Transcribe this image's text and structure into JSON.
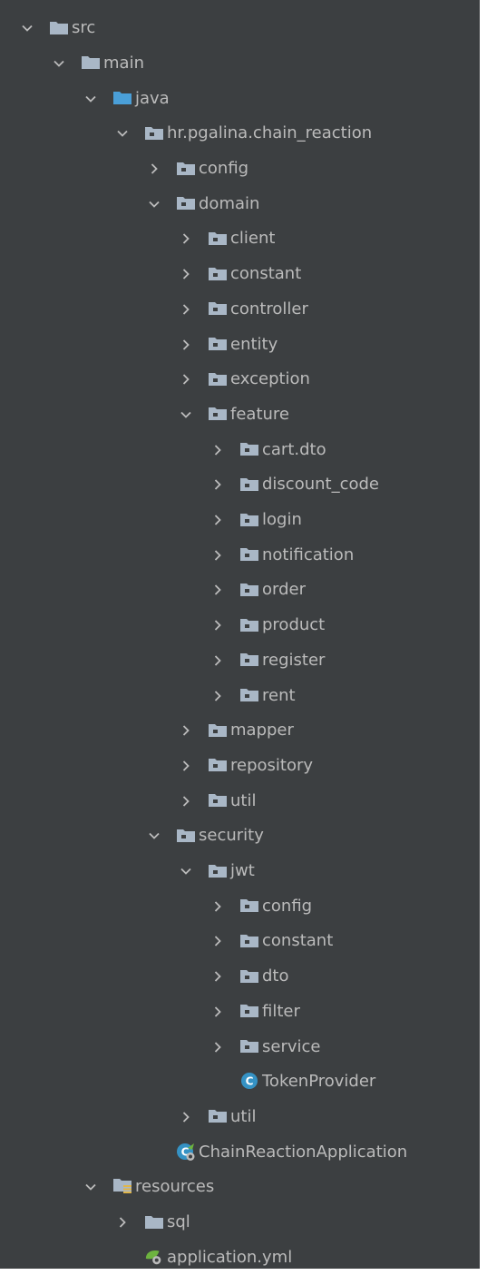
{
  "project_tree": {
    "colors": {
      "background": "#3c3f41",
      "text": "#bbbbbb",
      "folder": "#a9b7c6",
      "source_folder": "#4a9fd8",
      "package_dot": "#3c3f41",
      "class_badge": "#3592c4",
      "spring_leaf": "#6db33f",
      "resources_lines": "#e0b64a"
    },
    "nodes": [
      {
        "label": "src",
        "depth": 0,
        "state": "expanded",
        "icon": "folder-icon"
      },
      {
        "label": "main",
        "depth": 1,
        "state": "expanded",
        "icon": "folder-icon"
      },
      {
        "label": "java",
        "depth": 2,
        "state": "expanded",
        "icon": "source-folder-icon"
      },
      {
        "label": "hr.pgalina.chain_reaction",
        "depth": 3,
        "state": "expanded",
        "icon": "package-icon"
      },
      {
        "label": "config",
        "depth": 4,
        "state": "collapsed",
        "icon": "package-icon"
      },
      {
        "label": "domain",
        "depth": 4,
        "state": "expanded",
        "icon": "package-icon"
      },
      {
        "label": "client",
        "depth": 5,
        "state": "collapsed",
        "icon": "package-icon"
      },
      {
        "label": "constant",
        "depth": 5,
        "state": "collapsed",
        "icon": "package-icon"
      },
      {
        "label": "controller",
        "depth": 5,
        "state": "collapsed",
        "icon": "package-icon"
      },
      {
        "label": "entity",
        "depth": 5,
        "state": "collapsed",
        "icon": "package-icon"
      },
      {
        "label": "exception",
        "depth": 5,
        "state": "collapsed",
        "icon": "package-icon"
      },
      {
        "label": "feature",
        "depth": 5,
        "state": "expanded",
        "icon": "package-icon"
      },
      {
        "label": "cart.dto",
        "depth": 6,
        "state": "collapsed",
        "icon": "package-icon"
      },
      {
        "label": "discount_code",
        "depth": 6,
        "state": "collapsed",
        "icon": "package-icon"
      },
      {
        "label": "login",
        "depth": 6,
        "state": "collapsed",
        "icon": "package-icon"
      },
      {
        "label": "notification",
        "depth": 6,
        "state": "collapsed",
        "icon": "package-icon"
      },
      {
        "label": "order",
        "depth": 6,
        "state": "collapsed",
        "icon": "package-icon"
      },
      {
        "label": "product",
        "depth": 6,
        "state": "collapsed",
        "icon": "package-icon"
      },
      {
        "label": "register",
        "depth": 6,
        "state": "collapsed",
        "icon": "package-icon"
      },
      {
        "label": "rent",
        "depth": 6,
        "state": "collapsed",
        "icon": "package-icon"
      },
      {
        "label": "mapper",
        "depth": 5,
        "state": "collapsed",
        "icon": "package-icon"
      },
      {
        "label": "repository",
        "depth": 5,
        "state": "collapsed",
        "icon": "package-icon"
      },
      {
        "label": "util",
        "depth": 5,
        "state": "collapsed",
        "icon": "package-icon"
      },
      {
        "label": "security",
        "depth": 4,
        "state": "expanded",
        "icon": "package-icon"
      },
      {
        "label": "jwt",
        "depth": 5,
        "state": "expanded",
        "icon": "package-icon"
      },
      {
        "label": "config",
        "depth": 6,
        "state": "collapsed",
        "icon": "package-icon"
      },
      {
        "label": "constant",
        "depth": 6,
        "state": "collapsed",
        "icon": "package-icon"
      },
      {
        "label": "dto",
        "depth": 6,
        "state": "collapsed",
        "icon": "package-icon"
      },
      {
        "label": "filter",
        "depth": 6,
        "state": "collapsed",
        "icon": "package-icon"
      },
      {
        "label": "service",
        "depth": 6,
        "state": "collapsed",
        "icon": "package-icon"
      },
      {
        "label": "TokenProvider",
        "depth": 6,
        "state": "leaf",
        "icon": "class-icon"
      },
      {
        "label": "util",
        "depth": 5,
        "state": "collapsed",
        "icon": "package-icon"
      },
      {
        "label": "ChainReactionApplication",
        "depth": 4,
        "state": "leaf",
        "icon": "spring-boot-class-icon"
      },
      {
        "label": "resources",
        "depth": 2,
        "state": "expanded",
        "icon": "resources-folder-icon"
      },
      {
        "label": "sql",
        "depth": 3,
        "state": "collapsed",
        "icon": "folder-icon"
      },
      {
        "label": "application.yml",
        "depth": 3,
        "state": "leaf",
        "icon": "spring-config-file-icon"
      }
    ]
  }
}
